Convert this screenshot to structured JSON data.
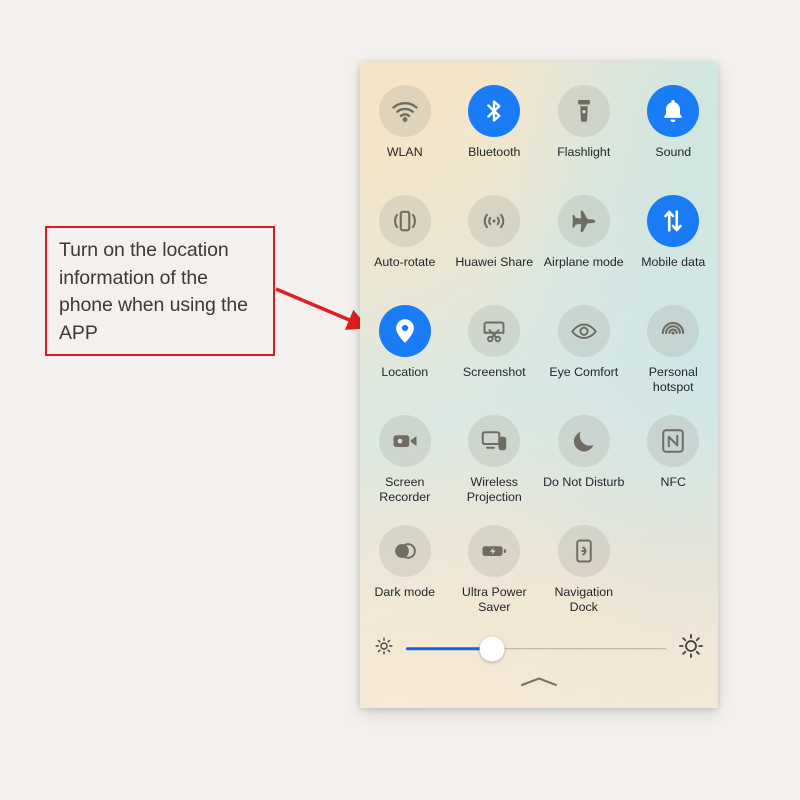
{
  "annotation": {
    "text": "Turn on the location information of the phone when using the APP",
    "border_color": "#cf2026",
    "arrow_color": "#e01f1f"
  },
  "panel": {
    "accent_on_color": "#1a7cf5",
    "background_note": "pastel cream-to-mint gradient",
    "tiles": [
      {
        "label": "WLAN",
        "icon": "wifi-icon",
        "state": "off"
      },
      {
        "label": "Bluetooth",
        "icon": "bluetooth-icon",
        "state": "on"
      },
      {
        "label": "Flashlight",
        "icon": "flashlight-icon",
        "state": "off"
      },
      {
        "label": "Sound",
        "icon": "bell-icon",
        "state": "on"
      },
      {
        "label": "Auto-rotate",
        "icon": "auto-rotate-icon",
        "state": "off"
      },
      {
        "label": "Huawei Share",
        "icon": "huawei-share-icon",
        "state": "off"
      },
      {
        "label": "Airplane mode",
        "icon": "airplane-icon",
        "state": "off"
      },
      {
        "label": "Mobile data",
        "icon": "mobile-data-arrows-icon",
        "state": "on"
      },
      {
        "label": "Location",
        "icon": "location-pin-icon",
        "state": "on"
      },
      {
        "label": "Screenshot",
        "icon": "screenshot-scissors-icon",
        "state": "off"
      },
      {
        "label": "Eye Comfort",
        "icon": "eye-icon",
        "state": "off"
      },
      {
        "label": "Personal hotspot",
        "icon": "hotspot-icon",
        "state": "off"
      },
      {
        "label": "Screen Recorder",
        "icon": "video-camera-icon",
        "state": "off"
      },
      {
        "label": "Wireless Projection",
        "icon": "cast-screen-icon",
        "state": "off"
      },
      {
        "label": "Do Not Disturb",
        "icon": "moon-icon",
        "state": "off"
      },
      {
        "label": "NFC",
        "icon": "nfc-icon",
        "state": "off"
      },
      {
        "label": "Dark mode",
        "icon": "dark-mode-circles-icon",
        "state": "off"
      },
      {
        "label": "Ultra Power Saver",
        "icon": "battery-bolt-icon",
        "state": "off"
      },
      {
        "label": "Navigation Dock",
        "icon": "navigation-dock-icon",
        "state": "off"
      }
    ],
    "brightness": {
      "low_icon": "brightness-low-icon",
      "high_icon": "brightness-high-icon",
      "value_percent": 33,
      "fill_color": "#1565d8"
    },
    "collapse_handle_icon": "chevron-up-icon"
  }
}
